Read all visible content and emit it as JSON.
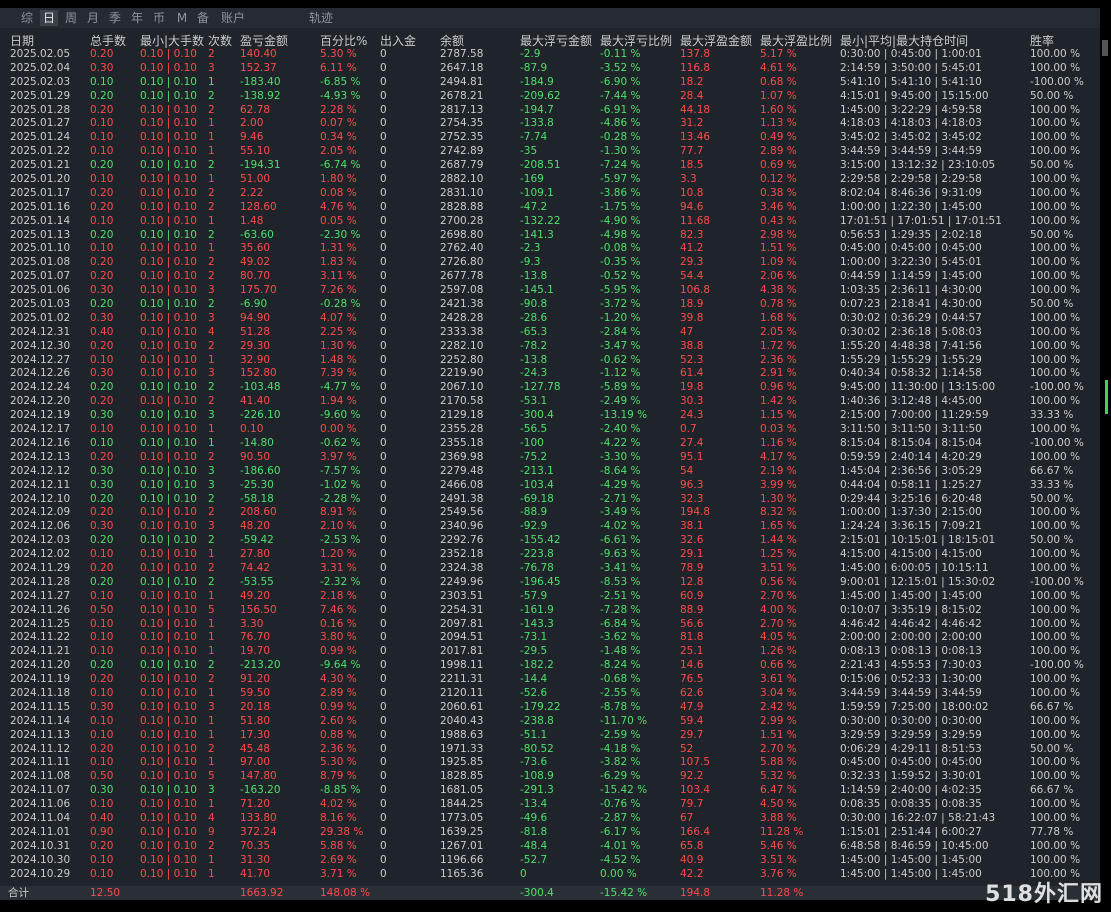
{
  "tabs": [
    {
      "label": "综",
      "active": false
    },
    {
      "label": "日",
      "active": true
    },
    {
      "label": "周",
      "active": false
    },
    {
      "label": "月",
      "active": false
    },
    {
      "label": "季",
      "active": false
    },
    {
      "label": "年",
      "active": false
    },
    {
      "label": "币",
      "active": false
    },
    {
      "label": "M",
      "active": false
    },
    {
      "label": "备",
      "active": false
    },
    {
      "label": "账户",
      "active": false
    },
    {
      "label": "轨迹",
      "active": false
    }
  ],
  "headers": [
    "日期",
    "总手数",
    "最小|大手数",
    "次数",
    "盈亏金额",
    "百分比%",
    "出入金",
    "余额",
    "最大浮亏金额",
    "最大浮亏比例",
    "最大浮盈金额",
    "最大浮盈比例",
    "最小|平均|最大持仓时间",
    "胜率"
  ],
  "rows": [
    [
      "2025.02.05",
      "0.20",
      "0.10 | 0.10",
      "2",
      "140.40",
      "5.30 %",
      "0",
      "2787.58",
      "-2.9",
      "-0.11 %",
      "137.8",
      "5.17 %",
      "0:30:00 | 0:45:00 | 1:00:01",
      "100.00 %"
    ],
    [
      "2025.02.04",
      "0.30",
      "0.10 | 0.10",
      "3",
      "152.37",
      "6.11 %",
      "0",
      "2647.18",
      "-87.9",
      "-3.52 %",
      "116.8",
      "4.61 %",
      "2:14:59 | 3:50:00 | 5:45:01",
      "100.00 %"
    ],
    [
      "2025.02.03",
      "0.10",
      "0.10 | 0.10",
      "1",
      "-183.40",
      "-6.85 %",
      "0",
      "2494.81",
      "-184.9",
      "-6.90 %",
      "18.2",
      "0.68 %",
      "5:41:10 | 5:41:10 | 5:41:10",
      "-100.00 %"
    ],
    [
      "2025.01.29",
      "0.20",
      "0.10 | 0.10",
      "2",
      "-138.92",
      "-4.93 %",
      "0",
      "2678.21",
      "-209.62",
      "-7.44 %",
      "28.4",
      "1.07 %",
      "4:15:01 | 9:45:00 | 15:15:00",
      "50.00 %"
    ],
    [
      "2025.01.28",
      "0.20",
      "0.10 | 0.10",
      "2",
      "62.78",
      "2.28 %",
      "0",
      "2817.13",
      "-194.7",
      "-6.91 %",
      "44.18",
      "1.60 %",
      "1:45:00 | 3:22:29 | 4:59:58",
      "100.00 %"
    ],
    [
      "2025.01.27",
      "0.10",
      "0.10 | 0.10",
      "1",
      "2.00",
      "0.07 %",
      "0",
      "2754.35",
      "-133.8",
      "-4.86 %",
      "31.2",
      "1.13 %",
      "4:18:03 | 4:18:03 | 4:18:03",
      "100.00 %"
    ],
    [
      "2025.01.24",
      "0.10",
      "0.10 | 0.10",
      "1",
      "9.46",
      "0.34 %",
      "0",
      "2752.35",
      "-7.74",
      "-0.28 %",
      "13.46",
      "0.49 %",
      "3:45:02 | 3:45:02 | 3:45:02",
      "100.00 %"
    ],
    [
      "2025.01.22",
      "0.10",
      "0.10 | 0.10",
      "1",
      "55.10",
      "2.05 %",
      "0",
      "2742.89",
      "-35",
      "-1.30 %",
      "77.7",
      "2.89 %",
      "3:44:59 | 3:44:59 | 3:44:59",
      "100.00 %"
    ],
    [
      "2025.01.21",
      "0.20",
      "0.10 | 0.10",
      "2",
      "-194.31",
      "-6.74 %",
      "0",
      "2687.79",
      "-208.51",
      "-7.24 %",
      "18.5",
      "0.69 %",
      "3:15:00 | 13:12:32 | 23:10:05",
      "50.00 %"
    ],
    [
      "2025.01.20",
      "0.10",
      "0.10 | 0.10",
      "1",
      "51.00",
      "1.80 %",
      "0",
      "2882.10",
      "-169",
      "-5.97 %",
      "3.3",
      "0.12 %",
      "2:29:58 | 2:29:58 | 2:29:58",
      "100.00 %"
    ],
    [
      "2025.01.17",
      "0.20",
      "0.10 | 0.10",
      "2",
      "2.22",
      "0.08 %",
      "0",
      "2831.10",
      "-109.1",
      "-3.86 %",
      "10.8",
      "0.38 %",
      "8:02:04 | 8:46:36 | 9:31:09",
      "100.00 %"
    ],
    [
      "2025.01.16",
      "0.20",
      "0.10 | 0.10",
      "2",
      "128.60",
      "4.76 %",
      "0",
      "2828.88",
      "-47.2",
      "-1.75 %",
      "94.6",
      "3.46 %",
      "1:00:00 | 1:22:30 | 1:45:00",
      "100.00 %"
    ],
    [
      "2025.01.14",
      "0.10",
      "0.10 | 0.10",
      "1",
      "1.48",
      "0.05 %",
      "0",
      "2700.28",
      "-132.22",
      "-4.90 %",
      "11.68",
      "0.43 %",
      "17:01:51 | 17:01:51 | 17:01:51",
      "100.00 %"
    ],
    [
      "2025.01.13",
      "0.20",
      "0.10 | 0.10",
      "2",
      "-63.60",
      "-2.30 %",
      "0",
      "2698.80",
      "-141.3",
      "-4.98 %",
      "82.3",
      "2.98 %",
      "0:56:53 | 1:29:35 | 2:02:18",
      "50.00 %"
    ],
    [
      "2025.01.10",
      "0.10",
      "0.10 | 0.10",
      "1",
      "35.60",
      "1.31 %",
      "0",
      "2762.40",
      "-2.3",
      "-0.08 %",
      "41.2",
      "1.51 %",
      "0:45:00 | 0:45:00 | 0:45:00",
      "100.00 %"
    ],
    [
      "2025.01.08",
      "0.20",
      "0.10 | 0.10",
      "2",
      "49.02",
      "1.83 %",
      "0",
      "2726.80",
      "-9.3",
      "-0.35 %",
      "29.3",
      "1.09 %",
      "1:00:00 | 3:22:30 | 5:45:01",
      "100.00 %"
    ],
    [
      "2025.01.07",
      "0.20",
      "0.10 | 0.10",
      "2",
      "80.70",
      "3.11 %",
      "0",
      "2677.78",
      "-13.8",
      "-0.52 %",
      "54.4",
      "2.06 %",
      "0:44:59 | 1:14:59 | 1:45:00",
      "100.00 %"
    ],
    [
      "2025.01.06",
      "0.30",
      "0.10 | 0.10",
      "3",
      "175.70",
      "7.26 %",
      "0",
      "2597.08",
      "-145.1",
      "-5.95 %",
      "106.8",
      "4.38 %",
      "1:03:35 | 2:36:11 | 4:30:00",
      "100.00 %"
    ],
    [
      "2025.01.03",
      "0.20",
      "0.10 | 0.10",
      "2",
      "-6.90",
      "-0.28 %",
      "0",
      "2421.38",
      "-90.8",
      "-3.72 %",
      "18.9",
      "0.78 %",
      "0:07:23 | 2:18:41 | 4:30:00",
      "50.00 %"
    ],
    [
      "2025.01.02",
      "0.30",
      "0.10 | 0.10",
      "3",
      "94.90",
      "4.07 %",
      "0",
      "2428.28",
      "-28.6",
      "-1.20 %",
      "39.8",
      "1.68 %",
      "0:30:02 | 0:36:29 | 0:44:57",
      "100.00 %"
    ],
    [
      "2024.12.31",
      "0.40",
      "0.10 | 0.10",
      "4",
      "51.28",
      "2.25 %",
      "0",
      "2333.38",
      "-65.3",
      "-2.84 %",
      "47",
      "2.05 %",
      "0:30:02 | 2:36:18 | 5:08:03",
      "100.00 %"
    ],
    [
      "2024.12.30",
      "0.20",
      "0.10 | 0.10",
      "2",
      "29.30",
      "1.30 %",
      "0",
      "2282.10",
      "-78.2",
      "-3.47 %",
      "38.8",
      "1.72 %",
      "1:55:20 | 4:48:38 | 7:41:56",
      "100.00 %"
    ],
    [
      "2024.12.27",
      "0.10",
      "0.10 | 0.10",
      "1",
      "32.90",
      "1.48 %",
      "0",
      "2252.80",
      "-13.8",
      "-0.62 %",
      "52.3",
      "2.36 %",
      "1:55:29 | 1:55:29 | 1:55:29",
      "100.00 %"
    ],
    [
      "2024.12.26",
      "0.30",
      "0.10 | 0.10",
      "3",
      "152.80",
      "7.39 %",
      "0",
      "2219.90",
      "-24.3",
      "-1.12 %",
      "61.4",
      "2.91 %",
      "0:40:34 | 0:58:32 | 1:14:58",
      "100.00 %"
    ],
    [
      "2024.12.24",
      "0.20",
      "0.10 | 0.10",
      "2",
      "-103.48",
      "-4.77 %",
      "0",
      "2067.10",
      "-127.78",
      "-5.89 %",
      "19.8",
      "0.96 %",
      "9:45:00 | 11:30:00 | 13:15:00",
      "-100.00 %"
    ],
    [
      "2024.12.20",
      "0.20",
      "0.10 | 0.10",
      "2",
      "41.40",
      "1.94 %",
      "0",
      "2170.58",
      "-53.1",
      "-2.49 %",
      "30.3",
      "1.42 %",
      "1:40:36 | 3:12:48 | 4:45:00",
      "100.00 %"
    ],
    [
      "2024.12.19",
      "0.30",
      "0.10 | 0.10",
      "3",
      "-226.10",
      "-9.60 %",
      "0",
      "2129.18",
      "-300.4",
      "-13.19 %",
      "24.3",
      "1.15 %",
      "2:15:00 | 7:00:00 | 11:29:59",
      "33.33 %"
    ],
    [
      "2024.12.17",
      "0.10",
      "0.10 | 0.10",
      "1",
      "0.10",
      "0.00 %",
      "0",
      "2355.28",
      "-56.5",
      "-2.40 %",
      "0.7",
      "0.03 %",
      "3:11:50 | 3:11:50 | 3:11:50",
      "100.00 %"
    ],
    [
      "2024.12.16",
      "0.10",
      "0.10 | 0.10",
      "1",
      "-14.80",
      "-0.62 %",
      "0",
      "2355.18",
      "-100",
      "-4.22 %",
      "27.4",
      "1.16 %",
      "8:15:04 | 8:15:04 | 8:15:04",
      "-100.00 %"
    ],
    [
      "2024.12.13",
      "0.20",
      "0.10 | 0.10",
      "2",
      "90.50",
      "3.97 %",
      "0",
      "2369.98",
      "-75.2",
      "-3.30 %",
      "95.1",
      "4.17 %",
      "0:59:59 | 2:40:14 | 4:20:29",
      "100.00 %"
    ],
    [
      "2024.12.12",
      "0.30",
      "0.10 | 0.10",
      "3",
      "-186.60",
      "-7.57 %",
      "0",
      "2279.48",
      "-213.1",
      "-8.64 %",
      "54",
      "2.19 %",
      "1:45:04 | 2:36:56 | 3:05:29",
      "66.67 %"
    ],
    [
      "2024.12.11",
      "0.30",
      "0.10 | 0.10",
      "3",
      "-25.30",
      "-1.02 %",
      "0",
      "2466.08",
      "-103.4",
      "-4.29 %",
      "96.3",
      "3.99 %",
      "0:44:04 | 0:58:11 | 1:25:27",
      "33.33 %"
    ],
    [
      "2024.12.10",
      "0.20",
      "0.10 | 0.10",
      "2",
      "-58.18",
      "-2.28 %",
      "0",
      "2491.38",
      "-69.18",
      "-2.71 %",
      "32.3",
      "1.30 %",
      "0:29:44 | 3:25:16 | 6:20:48",
      "50.00 %"
    ],
    [
      "2024.12.09",
      "0.20",
      "0.10 | 0.10",
      "2",
      "208.60",
      "8.91 %",
      "0",
      "2549.56",
      "-88.9",
      "-3.49 %",
      "194.8",
      "8.32 %",
      "1:00:00 | 1:37:30 | 2:15:00",
      "100.00 %"
    ],
    [
      "2024.12.06",
      "0.30",
      "0.10 | 0.10",
      "3",
      "48.20",
      "2.10 %",
      "0",
      "2340.96",
      "-92.9",
      "-4.02 %",
      "38.1",
      "1.65 %",
      "1:24:24 | 3:36:15 | 7:09:21",
      "100.00 %"
    ],
    [
      "2024.12.03",
      "0.20",
      "0.10 | 0.10",
      "2",
      "-59.42",
      "-2.53 %",
      "0",
      "2292.76",
      "-155.42",
      "-6.61 %",
      "32.6",
      "1.44 %",
      "2:15:01 | 10:15:01 | 18:15:01",
      "50.00 %"
    ],
    [
      "2024.12.02",
      "0.10",
      "0.10 | 0.10",
      "1",
      "27.80",
      "1.20 %",
      "0",
      "2352.18",
      "-223.8",
      "-9.63 %",
      "29.1",
      "1.25 %",
      "4:15:00 | 4:15:00 | 4:15:00",
      "100.00 %"
    ],
    [
      "2024.11.29",
      "0.20",
      "0.10 | 0.10",
      "2",
      "74.42",
      "3.31 %",
      "0",
      "2324.38",
      "-76.78",
      "-3.41 %",
      "78.9",
      "3.51 %",
      "1:45:00 | 6:00:05 | 10:15:11",
      "100.00 %"
    ],
    [
      "2024.11.28",
      "0.20",
      "0.10 | 0.10",
      "2",
      "-53.55",
      "-2.32 %",
      "0",
      "2249.96",
      "-196.45",
      "-8.53 %",
      "12.8",
      "0.56 %",
      "9:00:01 | 12:15:01 | 15:30:02",
      "-100.00 %"
    ],
    [
      "2024.11.27",
      "0.10",
      "0.10 | 0.10",
      "1",
      "49.20",
      "2.18 %",
      "0",
      "2303.51",
      "-57.9",
      "-2.51 %",
      "60.9",
      "2.70 %",
      "1:45:00 | 1:45:00 | 1:45:00",
      "100.00 %"
    ],
    [
      "2024.11.26",
      "0.50",
      "0.10 | 0.10",
      "5",
      "156.50",
      "7.46 %",
      "0",
      "2254.31",
      "-161.9",
      "-7.28 %",
      "88.9",
      "4.00 %",
      "0:10:07 | 3:35:19 | 8:15:02",
      "100.00 %"
    ],
    [
      "2024.11.25",
      "0.10",
      "0.10 | 0.10",
      "1",
      "3.30",
      "0.16 %",
      "0",
      "2097.81",
      "-143.3",
      "-6.84 %",
      "56.6",
      "2.70 %",
      "4:46:42 | 4:46:42 | 4:46:42",
      "100.00 %"
    ],
    [
      "2024.11.22",
      "0.10",
      "0.10 | 0.10",
      "1",
      "76.70",
      "3.80 %",
      "0",
      "2094.51",
      "-73.1",
      "-3.62 %",
      "81.8",
      "4.05 %",
      "2:00:00 | 2:00:00 | 2:00:00",
      "100.00 %"
    ],
    [
      "2024.11.21",
      "0.10",
      "0.10 | 0.10",
      "1",
      "19.70",
      "0.99 %",
      "0",
      "2017.81",
      "-29.5",
      "-1.48 %",
      "25.1",
      "1.26 %",
      "0:08:13 | 0:08:13 | 0:08:13",
      "100.00 %"
    ],
    [
      "2024.11.20",
      "0.20",
      "0.10 | 0.10",
      "2",
      "-213.20",
      "-9.64 %",
      "0",
      "1998.11",
      "-182.2",
      "-8.24 %",
      "14.6",
      "0.66 %",
      "2:21:43 | 4:55:53 | 7:30:03",
      "-100.00 %"
    ],
    [
      "2024.11.19",
      "0.20",
      "0.10 | 0.10",
      "2",
      "91.20",
      "4.30 %",
      "0",
      "2211.31",
      "-14.4",
      "-0.68 %",
      "76.5",
      "3.61 %",
      "0:15:06 | 0:52:33 | 1:30:00",
      "100.00 %"
    ],
    [
      "2024.11.18",
      "0.10",
      "0.10 | 0.10",
      "1",
      "59.50",
      "2.89 %",
      "0",
      "2120.11",
      "-52.6",
      "-2.55 %",
      "62.6",
      "3.04 %",
      "3:44:59 | 3:44:59 | 3:44:59",
      "100.00 %"
    ],
    [
      "2024.11.15",
      "0.30",
      "0.10 | 0.10",
      "3",
      "20.18",
      "0.99 %",
      "0",
      "2060.61",
      "-179.22",
      "-8.78 %",
      "47.9",
      "2.42 %",
      "1:59:59 | 7:25:00 | 18:00:02",
      "66.67 %"
    ],
    [
      "2024.11.14",
      "0.10",
      "0.10 | 0.10",
      "1",
      "51.80",
      "2.60 %",
      "0",
      "2040.43",
      "-238.8",
      "-11.70 %",
      "59.4",
      "2.99 %",
      "0:30:00 | 0:30:00 | 0:30:00",
      "100.00 %"
    ],
    [
      "2024.11.13",
      "0.10",
      "0.10 | 0.10",
      "1",
      "17.30",
      "0.88 %",
      "0",
      "1988.63",
      "-51.1",
      "-2.59 %",
      "29.7",
      "1.51 %",
      "3:29:59 | 3:29:59 | 3:29:59",
      "100.00 %"
    ],
    [
      "2024.11.12",
      "0.20",
      "0.10 | 0.10",
      "2",
      "45.48",
      "2.36 %",
      "0",
      "1971.33",
      "-80.52",
      "-4.18 %",
      "52",
      "2.70 %",
      "0:06:29 | 4:29:11 | 8:51:53",
      "50.00 %"
    ],
    [
      "2024.11.11",
      "0.10",
      "0.10 | 0.10",
      "1",
      "97.00",
      "5.30 %",
      "0",
      "1925.85",
      "-73.6",
      "-3.82 %",
      "107.5",
      "5.88 %",
      "0:45:00 | 0:45:00 | 0:45:00",
      "100.00 %"
    ],
    [
      "2024.11.08",
      "0.50",
      "0.10 | 0.10",
      "5",
      "147.80",
      "8.79 %",
      "0",
      "1828.85",
      "-108.9",
      "-6.29 %",
      "92.2",
      "5.32 %",
      "0:32:33 | 1:59:52 | 3:30:01",
      "100.00 %"
    ],
    [
      "2024.11.07",
      "0.30",
      "0.10 | 0.10",
      "3",
      "-163.20",
      "-8.85 %",
      "0",
      "1681.05",
      "-291.3",
      "-15.42 %",
      "103.4",
      "6.47 %",
      "1:14:59 | 2:40:00 | 4:02:35",
      "66.67 %"
    ],
    [
      "2024.11.06",
      "0.10",
      "0.10 | 0.10",
      "1",
      "71.20",
      "4.02 %",
      "0",
      "1844.25",
      "-13.4",
      "-0.76 %",
      "79.7",
      "4.50 %",
      "0:08:35 | 0:08:35 | 0:08:35",
      "100.00 %"
    ],
    [
      "2024.11.04",
      "0.40",
      "0.10 | 0.10",
      "4",
      "133.80",
      "8.16 %",
      "0",
      "1773.05",
      "-49.6",
      "-2.87 %",
      "67",
      "3.88 %",
      "0:30:00 | 16:22:07 | 58:21:43",
      "100.00 %"
    ],
    [
      "2024.11.01",
      "0.90",
      "0.10 | 0.10",
      "9",
      "372.24",
      "29.38 %",
      "0",
      "1639.25",
      "-81.8",
      "-6.17 %",
      "166.4",
      "11.28 %",
      "1:15:01 | 2:51:44 | 6:00:27",
      "77.78 %"
    ],
    [
      "2024.10.31",
      "0.20",
      "0.10 | 0.10",
      "2",
      "70.35",
      "5.88 %",
      "0",
      "1267.01",
      "-48.4",
      "-4.01 %",
      "65.8",
      "5.46 %",
      "6:48:58 | 8:46:59 | 10:45:00",
      "100.00 %"
    ],
    [
      "2024.10.30",
      "0.10",
      "0.10 | 0.10",
      "1",
      "31.30",
      "2.69 %",
      "0",
      "1196.66",
      "-52.7",
      "-4.52 %",
      "40.9",
      "3.51 %",
      "1:45:00 | 1:45:00 | 1:45:00",
      "100.00 %"
    ],
    [
      "2024.10.29",
      "0.10",
      "0.10 | 0.10",
      "1",
      "41.70",
      "3.71 %",
      "0",
      "1165.36",
      "0",
      "0.00 %",
      "42.2",
      "3.76 %",
      "1:45:00 | 1:45:00 | 1:45:00",
      "100.00 %"
    ]
  ],
  "summary": {
    "label": "合计",
    "lots": "12.50",
    "pnl": "1663.92",
    "pct": "148.08 %",
    "max_dd": "-300.4",
    "max_dd_pct": "-15.42 %",
    "max_fp": "194.8",
    "max_fp_pct": "11.28 %"
  },
  "watermark": "518外汇网",
  "colors": {
    "profit": "#ff4a4a",
    "loss": "#4ee06a",
    "text": "#c9cdd1",
    "bg": "#1f232a"
  }
}
